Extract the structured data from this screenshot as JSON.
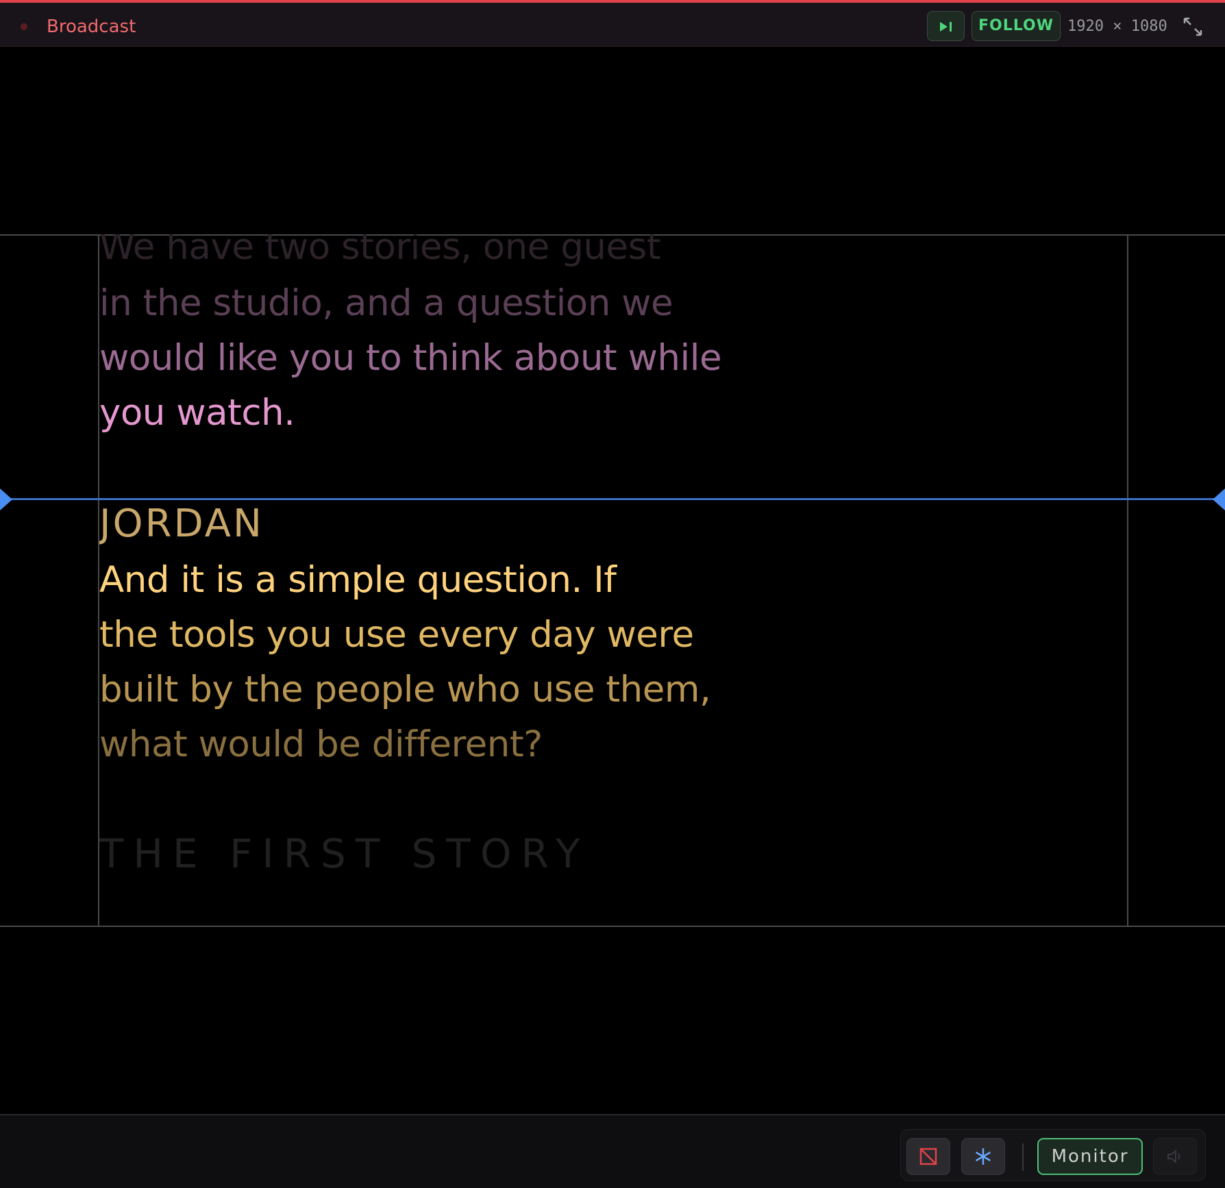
{
  "header": {
    "title": "Broadcast",
    "follow_label": "FOLLOW",
    "resolution": "1920 × 1080",
    "accent_color": "#e0424a",
    "follow_color": "#4ed67c"
  },
  "script": {
    "lines": [
      "We have two stories, one guest",
      "in the studio, and a question we",
      "would like you to think about while",
      "you watch.",
      "JORDAN",
      "And it is a simple question. If",
      "the tools you use every day were",
      "built by the people who use them,",
      "what would be different?",
      "THE FIRST STORY"
    ],
    "speaker": "JORDAN",
    "next_heading": "THE FIRST STORY",
    "past_color": "#e98fce",
    "current_color": "#f5c66a",
    "cue_color": "#4a8df0"
  },
  "controls": {
    "monitor_label": "Monitor",
    "icons": [
      "step-forward-icon",
      "expand-icon",
      "no-screen-icon",
      "asterisk-icon",
      "volume-icon"
    ],
    "monitor_active_color": "#4fbf77"
  }
}
